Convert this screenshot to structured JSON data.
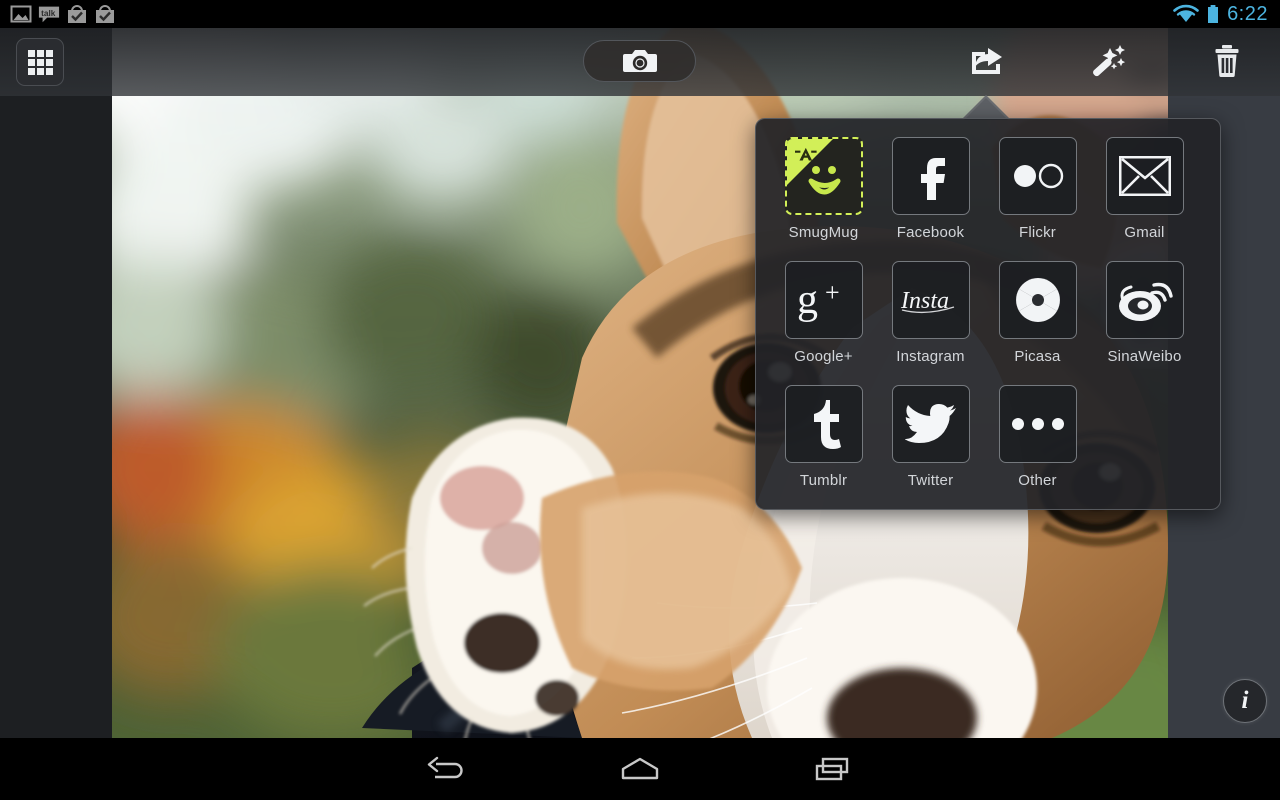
{
  "status_bar": {
    "notification_icons": [
      {
        "name": "gallery-image-icon",
        "label": "Gallery"
      },
      {
        "name": "talk-icon",
        "label": "talk"
      },
      {
        "name": "download-check-icon-1",
        "label": "Download complete"
      },
      {
        "name": "download-check-icon-2",
        "label": "Download complete"
      }
    ],
    "wifi_icon": "wifi-icon",
    "battery_icon": "battery-icon",
    "clock": "6:22",
    "accent_color": "#4cb4e0"
  },
  "toolbar": {
    "grid_button": {
      "name": "grid-view-button",
      "icon": "grid-icon",
      "label": "Grid view"
    },
    "camera_button": {
      "name": "camera-button",
      "icon": "camera-icon",
      "label": "Camera"
    },
    "share_button": {
      "name": "share-button",
      "icon": "share-icon",
      "label": "Share"
    },
    "edit_button": {
      "name": "magic-edit-button",
      "icon": "magic-wand-icon",
      "label": "Edit"
    },
    "delete_button": {
      "name": "delete-button",
      "icon": "trash-icon",
      "label": "Delete"
    }
  },
  "share_popup": {
    "visible": true,
    "selected": "SmugMug",
    "selection_color": "#d2ef58",
    "items": [
      {
        "label": "SmugMug",
        "icon": "smugmug-icon",
        "selected": true
      },
      {
        "label": "Facebook",
        "icon": "facebook-icon",
        "selected": false
      },
      {
        "label": "Flickr",
        "icon": "flickr-icon",
        "selected": false
      },
      {
        "label": "Gmail",
        "icon": "gmail-icon",
        "selected": false
      },
      {
        "label": "Google+",
        "icon": "googleplus-icon",
        "selected": false
      },
      {
        "label": "Instagram",
        "icon": "instagram-icon",
        "selected": false
      },
      {
        "label": "Picasa",
        "icon": "picasa-icon",
        "selected": false
      },
      {
        "label": "SinaWeibo",
        "icon": "sinaweibo-icon",
        "selected": false
      },
      {
        "label": "Tumblr",
        "icon": "tumblr-icon",
        "selected": false
      },
      {
        "label": "Twitter",
        "icon": "twitter-icon",
        "selected": false
      },
      {
        "label": "Other",
        "icon": "more-dots-icon",
        "selected": false
      }
    ]
  },
  "photo": {
    "name": "corgi-puppy-photo",
    "description": "Close-up of a corgi puppy being held by a person outdoors with blurred green and orange bokeh background"
  },
  "info_button": {
    "name": "info-button",
    "glyph": "i",
    "label": "Info"
  },
  "nav_bar": {
    "back": {
      "name": "nav-back-button",
      "icon": "back-arrow-icon",
      "label": "Back"
    },
    "home": {
      "name": "nav-home-button",
      "icon": "home-icon",
      "label": "Home"
    },
    "recents": {
      "name": "nav-recents-button",
      "icon": "recents-icon",
      "label": "Recent apps"
    }
  }
}
